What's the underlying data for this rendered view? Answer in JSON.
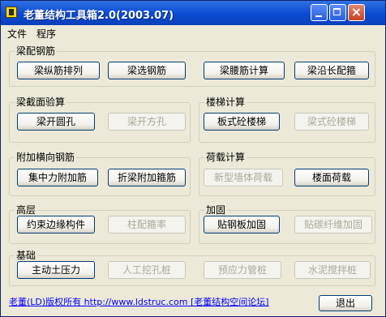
{
  "window": {
    "title": "老董结构工具箱2.0(2003.07)"
  },
  "menu": [
    "文件",
    "程序"
  ],
  "groups": {
    "liangpei": {
      "label": "梁配钢筋",
      "buttons": [
        "梁纵筋排列",
        "梁选钢筋",
        "梁腰筋计算",
        "梁沿长配箍"
      ]
    },
    "liangjiemian": {
      "label": "梁截面验算",
      "buttons": [
        "梁开圆孔",
        "梁开方孔"
      ]
    },
    "louti": {
      "label": "楼梯计算",
      "buttons": [
        "板式砼楼梯",
        "梁式砼楼梯"
      ]
    },
    "fujia": {
      "label": "附加横向钢筋",
      "buttons": [
        "集中力附加筋",
        "折梁附加箍筋"
      ]
    },
    "hezai": {
      "label": "荷载计算",
      "buttons": [
        "新型墙体荷载",
        "楼面荷载"
      ]
    },
    "gaoceng": {
      "label": "高层",
      "buttons": [
        "约束边缘构件",
        "柱配箍率"
      ]
    },
    "jiagu": {
      "label": "加固",
      "buttons": [
        "贴钢板加固",
        "贴碳纤维加固"
      ]
    },
    "jichu": {
      "label": "基础",
      "buttons": [
        "主动土压力",
        "人工挖孔桩",
        "预应力管桩",
        "水泥搅拌桩"
      ]
    }
  },
  "footer": {
    "link_text": "老董(LD)版权所有 http://www.ldstruc.com [老董结构空间论坛]",
    "exit_label": "退出"
  },
  "colors": {
    "titlebar": "#0a4bd2",
    "face": "#ece9d8",
    "link": "#0000ff",
    "disabled_text": "#aca899"
  }
}
